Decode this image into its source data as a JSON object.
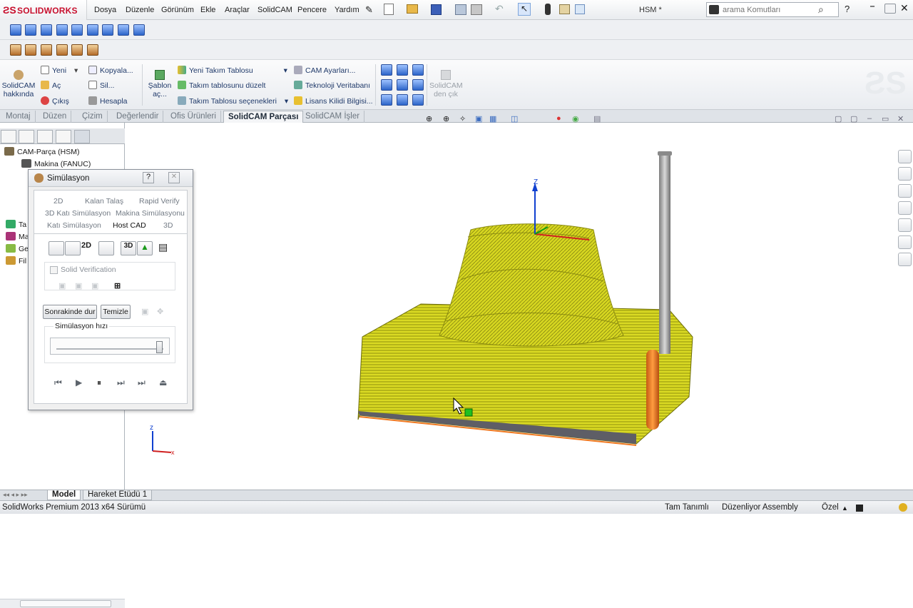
{
  "app": {
    "brand": "SOLIDWORKS",
    "title": "HSM *"
  },
  "menu": [
    "Dosya",
    "Düzenle",
    "Görünüm",
    "Ekle",
    "Araçlar",
    "SolidCAM",
    "Pencere",
    "Yardım"
  ],
  "search": {
    "placeholder": "arama Komutları"
  },
  "ribbon": {
    "about": "SolidCAM hakkında",
    "new": "Yeni",
    "open": "Aç",
    "exit": "Çıkış",
    "copy": "Kopyala...",
    "delete": "Sil...",
    "calculate": "Hesapla",
    "template": "Şablon aç...",
    "new_tool_table": "Yeni Takım Tablosu",
    "edit_tool_table": "Takım tablosunu düzelt",
    "tool_table_options": "Takım Tablosu seçenekleri",
    "cam_settings": "CAM Ayarları...",
    "tech_db": "Teknoloji Veritabanı",
    "license": "Lisans Kilidi Bilgisi...",
    "exit_solidcam": "SolidCAM den çık"
  },
  "command_tabs": [
    "Montaj",
    "Düzen",
    "Çizim",
    "Değerlendir",
    "Ofis Ürünleri",
    "SolidCAM Parçası",
    "SolidCAM İşler"
  ],
  "active_command_tab": "SolidCAM Parçası",
  "tree": {
    "root": "CAM-Parça (HSM)",
    "machine": "Makina (FANUC)",
    "partial": [
      "Ta",
      "Ma",
      "Ge",
      "Fil"
    ]
  },
  "simulation": {
    "title": "Simülasyon",
    "tabs_row1": [
      "2D",
      "Kalan Talaş",
      "Rapid Verify"
    ],
    "tabs_row2": [
      "3D Katı Simülasyon",
      "Makina Simülasyonu"
    ],
    "tabs_row3": [
      "Katı Simülasyon",
      "Host CAD",
      "3D"
    ],
    "active_tab": "Host CAD",
    "solid_verification": "Solid Verification",
    "stop_next": "Sonrakinde dur",
    "clear": "Temizle",
    "speed_label": "Simülasyon hızı",
    "speed": 0.95
  },
  "bottom_tabs": [
    "Model",
    "Hareket Etüdü 1"
  ],
  "status": {
    "version": "SolidWorks Premium 2013 x64 Sürümü",
    "defined": "Tam Tanımlı",
    "editing": "Düzenliyor Assembly",
    "custom": "Özel"
  },
  "colors": {
    "toolpath": "#f2f21a",
    "tool_holder": "#e8731c",
    "axis_z": "#1040d0",
    "axis_x": "#d02020",
    "axis_y": "#10a010"
  }
}
